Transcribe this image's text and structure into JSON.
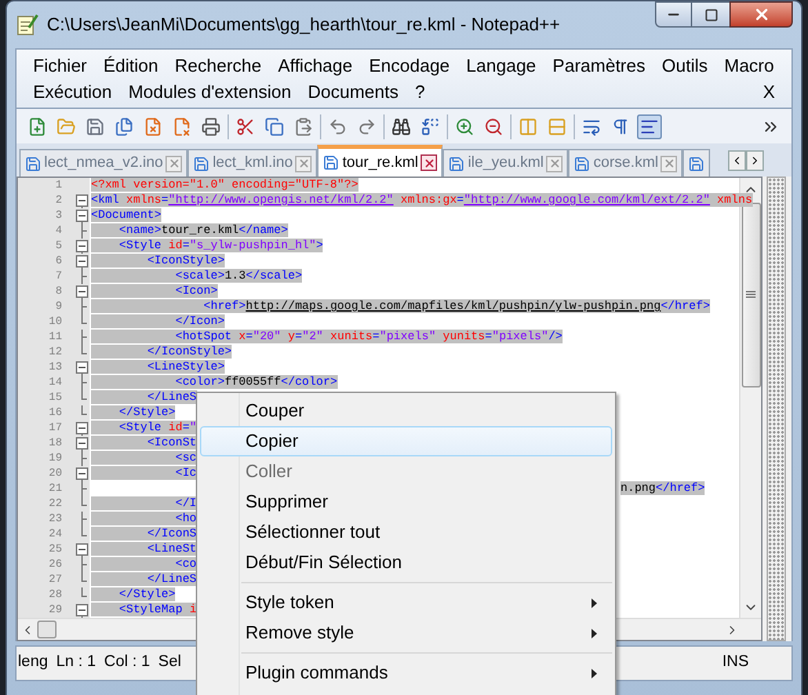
{
  "window": {
    "title": "C:\\Users\\JeanMi\\Documents\\gg_hearth\\tour_re.kml - Notepad++"
  },
  "menu_bar": {
    "items": [
      {
        "label": "Fichier"
      },
      {
        "label": "Édition"
      },
      {
        "label": "Recherche"
      },
      {
        "label": "Affichage"
      },
      {
        "label": "Encodage"
      },
      {
        "label": "Langage"
      },
      {
        "label": "Paramètres"
      },
      {
        "label": "Outils"
      },
      {
        "label": "Macro"
      },
      {
        "label": "Exécution"
      },
      {
        "label": "Modules d'extension"
      },
      {
        "label": "Documents"
      },
      {
        "label": "?"
      }
    ],
    "close": "X"
  },
  "toolbar": [
    {
      "kind": "new",
      "pressed": false
    },
    {
      "kind": "open",
      "pressed": false
    },
    {
      "kind": "save",
      "pressed": false
    },
    {
      "kind": "save_all",
      "pressed": false
    },
    {
      "kind": "close",
      "pressed": false
    },
    {
      "kind": "close_all",
      "pressed": false
    },
    {
      "kind": "print",
      "pressed": false
    },
    {
      "kind": "separator"
    },
    {
      "kind": "cut",
      "pressed": false
    },
    {
      "kind": "copy",
      "pressed": false
    },
    {
      "kind": "paste",
      "pressed": false
    },
    {
      "kind": "separator"
    },
    {
      "kind": "undo",
      "pressed": false
    },
    {
      "kind": "redo",
      "pressed": false
    },
    {
      "kind": "separator"
    },
    {
      "kind": "find",
      "pressed": false
    },
    {
      "kind": "replace",
      "pressed": false
    },
    {
      "kind": "separator"
    },
    {
      "kind": "zoom_in",
      "pressed": false
    },
    {
      "kind": "zoom_out",
      "pressed": false
    },
    {
      "kind": "separator"
    },
    {
      "kind": "sync_v",
      "pressed": false
    },
    {
      "kind": "sync_h",
      "pressed": false
    },
    {
      "kind": "separator"
    },
    {
      "kind": "wrap",
      "pressed": false
    },
    {
      "kind": "all_chars",
      "pressed": false
    },
    {
      "kind": "indent_guide",
      "pressed": true
    },
    {
      "kind": "more",
      "pressed": false
    }
  ],
  "tabs": [
    {
      "label": "lect_nmea_v2.ino",
      "selected": false
    },
    {
      "label": "lect_kml.ino",
      "selected": false
    },
    {
      "label": "tour_re.kml",
      "selected": true
    },
    {
      "label": "ile_yeu.kml",
      "selected": false
    },
    {
      "label": "corse.kml",
      "selected": false
    },
    {
      "selected": false
    }
  ],
  "editor": {
    "lines": [
      {
        "number": "1",
        "text": "<?xml version=\"1.0\" encoding=\"UTF-8\"?>"
      },
      {
        "number": "2",
        "kind": "fold_box",
        "text": "<kml xmlns=\"http://www.opengis.net/kml/2.2\" xmlns:gx=\"http://www.google.com/kml/ext/2.2\" xmlns"
      },
      {
        "number": "3",
        "kind": "fold_box",
        "text": "<Document>"
      },
      {
        "number": "4",
        "kind": "fold_line",
        "text": "    <name>tour_re.kml</name>"
      },
      {
        "number": "5",
        "kind": "fold_box",
        "text": "    <Style id=\"s_ylw-pushpin_hl\">"
      },
      {
        "number": "6",
        "kind": "fold_box",
        "text": "        <IconStyle>"
      },
      {
        "number": "7",
        "kind": "fold_line",
        "text": "            <scale>1.3</scale>"
      },
      {
        "number": "8",
        "kind": "fold_box",
        "text": "            <Icon>"
      },
      {
        "number": "9",
        "kind": "fold_line",
        "text": "                <href>http://maps.google.com/mapfiles/kml/pushpin/ylw-pushpin.png</href>"
      },
      {
        "number": "10",
        "kind": "fold_end",
        "text": "            </Icon>"
      },
      {
        "number": "11",
        "kind": "fold_line",
        "text": "            <hotSpot x=\"20\" y=\"2\" xunits=\"pixels\" yunits=\"pixels\"/>"
      },
      {
        "number": "12",
        "kind": "fold_end",
        "text": "        </IconStyle>"
      },
      {
        "number": "13",
        "kind": "fold_box",
        "text": "        <LineStyle>"
      },
      {
        "number": "14",
        "kind": "fold_line",
        "text": "            <color>ff0055ff</color>"
      },
      {
        "number": "15",
        "kind": "fold_end",
        "text": "        </LineS"
      },
      {
        "number": "16",
        "kind": "fold_end",
        "text": "    </Style>"
      },
      {
        "number": "17",
        "kind": "fold_box",
        "text": "    <Style id=\""
      },
      {
        "number": "18",
        "kind": "fold_box",
        "text": "        <IconSt"
      },
      {
        "number": "19",
        "kind": "fold_line",
        "text": "            <sc"
      },
      {
        "number": "20",
        "kind": "fold_box",
        "text": "            <Ic"
      },
      {
        "number": "21",
        "kind": "fold_line",
        "text_right": "n.png</href>"
      },
      {
        "number": "22",
        "kind": "fold_end",
        "text": "            </I"
      },
      {
        "number": "23",
        "kind": "fold_line",
        "text": "            <ho"
      },
      {
        "number": "24",
        "kind": "fold_end",
        "text": "        </IconS"
      },
      {
        "number": "25",
        "kind": "fold_box",
        "text": "        <LineSt"
      },
      {
        "number": "26",
        "kind": "fold_line",
        "text": "            <co"
      },
      {
        "number": "27",
        "kind": "fold_end",
        "text": "        </LineS"
      },
      {
        "number": "28",
        "kind": "fold_end",
        "text": "    </Style>"
      },
      {
        "number": "29",
        "kind": "fold_box",
        "text": "    <StyleMap i"
      }
    ]
  },
  "status_bar": {
    "fields": [
      "leng",
      "Ln : 1",
      "Col : 1",
      "Sel"
    ],
    "mode": "INS"
  },
  "context_menu": [
    {
      "kind": "item",
      "label": "Couper",
      "disabled": false,
      "selected": false
    },
    {
      "kind": "item",
      "label": "Copier",
      "disabled": false,
      "selected": true
    },
    {
      "kind": "item",
      "label": "Coller",
      "disabled": true,
      "selected": false
    },
    {
      "kind": "item",
      "label": "Supprimer",
      "disabled": false,
      "selected": false
    },
    {
      "kind": "item",
      "label": "Sélectionner tout",
      "disabled": false,
      "selected": false
    },
    {
      "kind": "item",
      "label": "Début/Fin Sélection",
      "disabled": false,
      "selected": false
    },
    {
      "kind": "separator"
    },
    {
      "kind": "submenu",
      "label": "Style token",
      "disabled": false,
      "selected": false
    },
    {
      "kind": "submenu",
      "label": "Remove style",
      "disabled": false,
      "selected": false
    },
    {
      "kind": "separator"
    },
    {
      "kind": "submenu",
      "label": "Plugin commands",
      "disabled": false,
      "selected": false
    }
  ]
}
